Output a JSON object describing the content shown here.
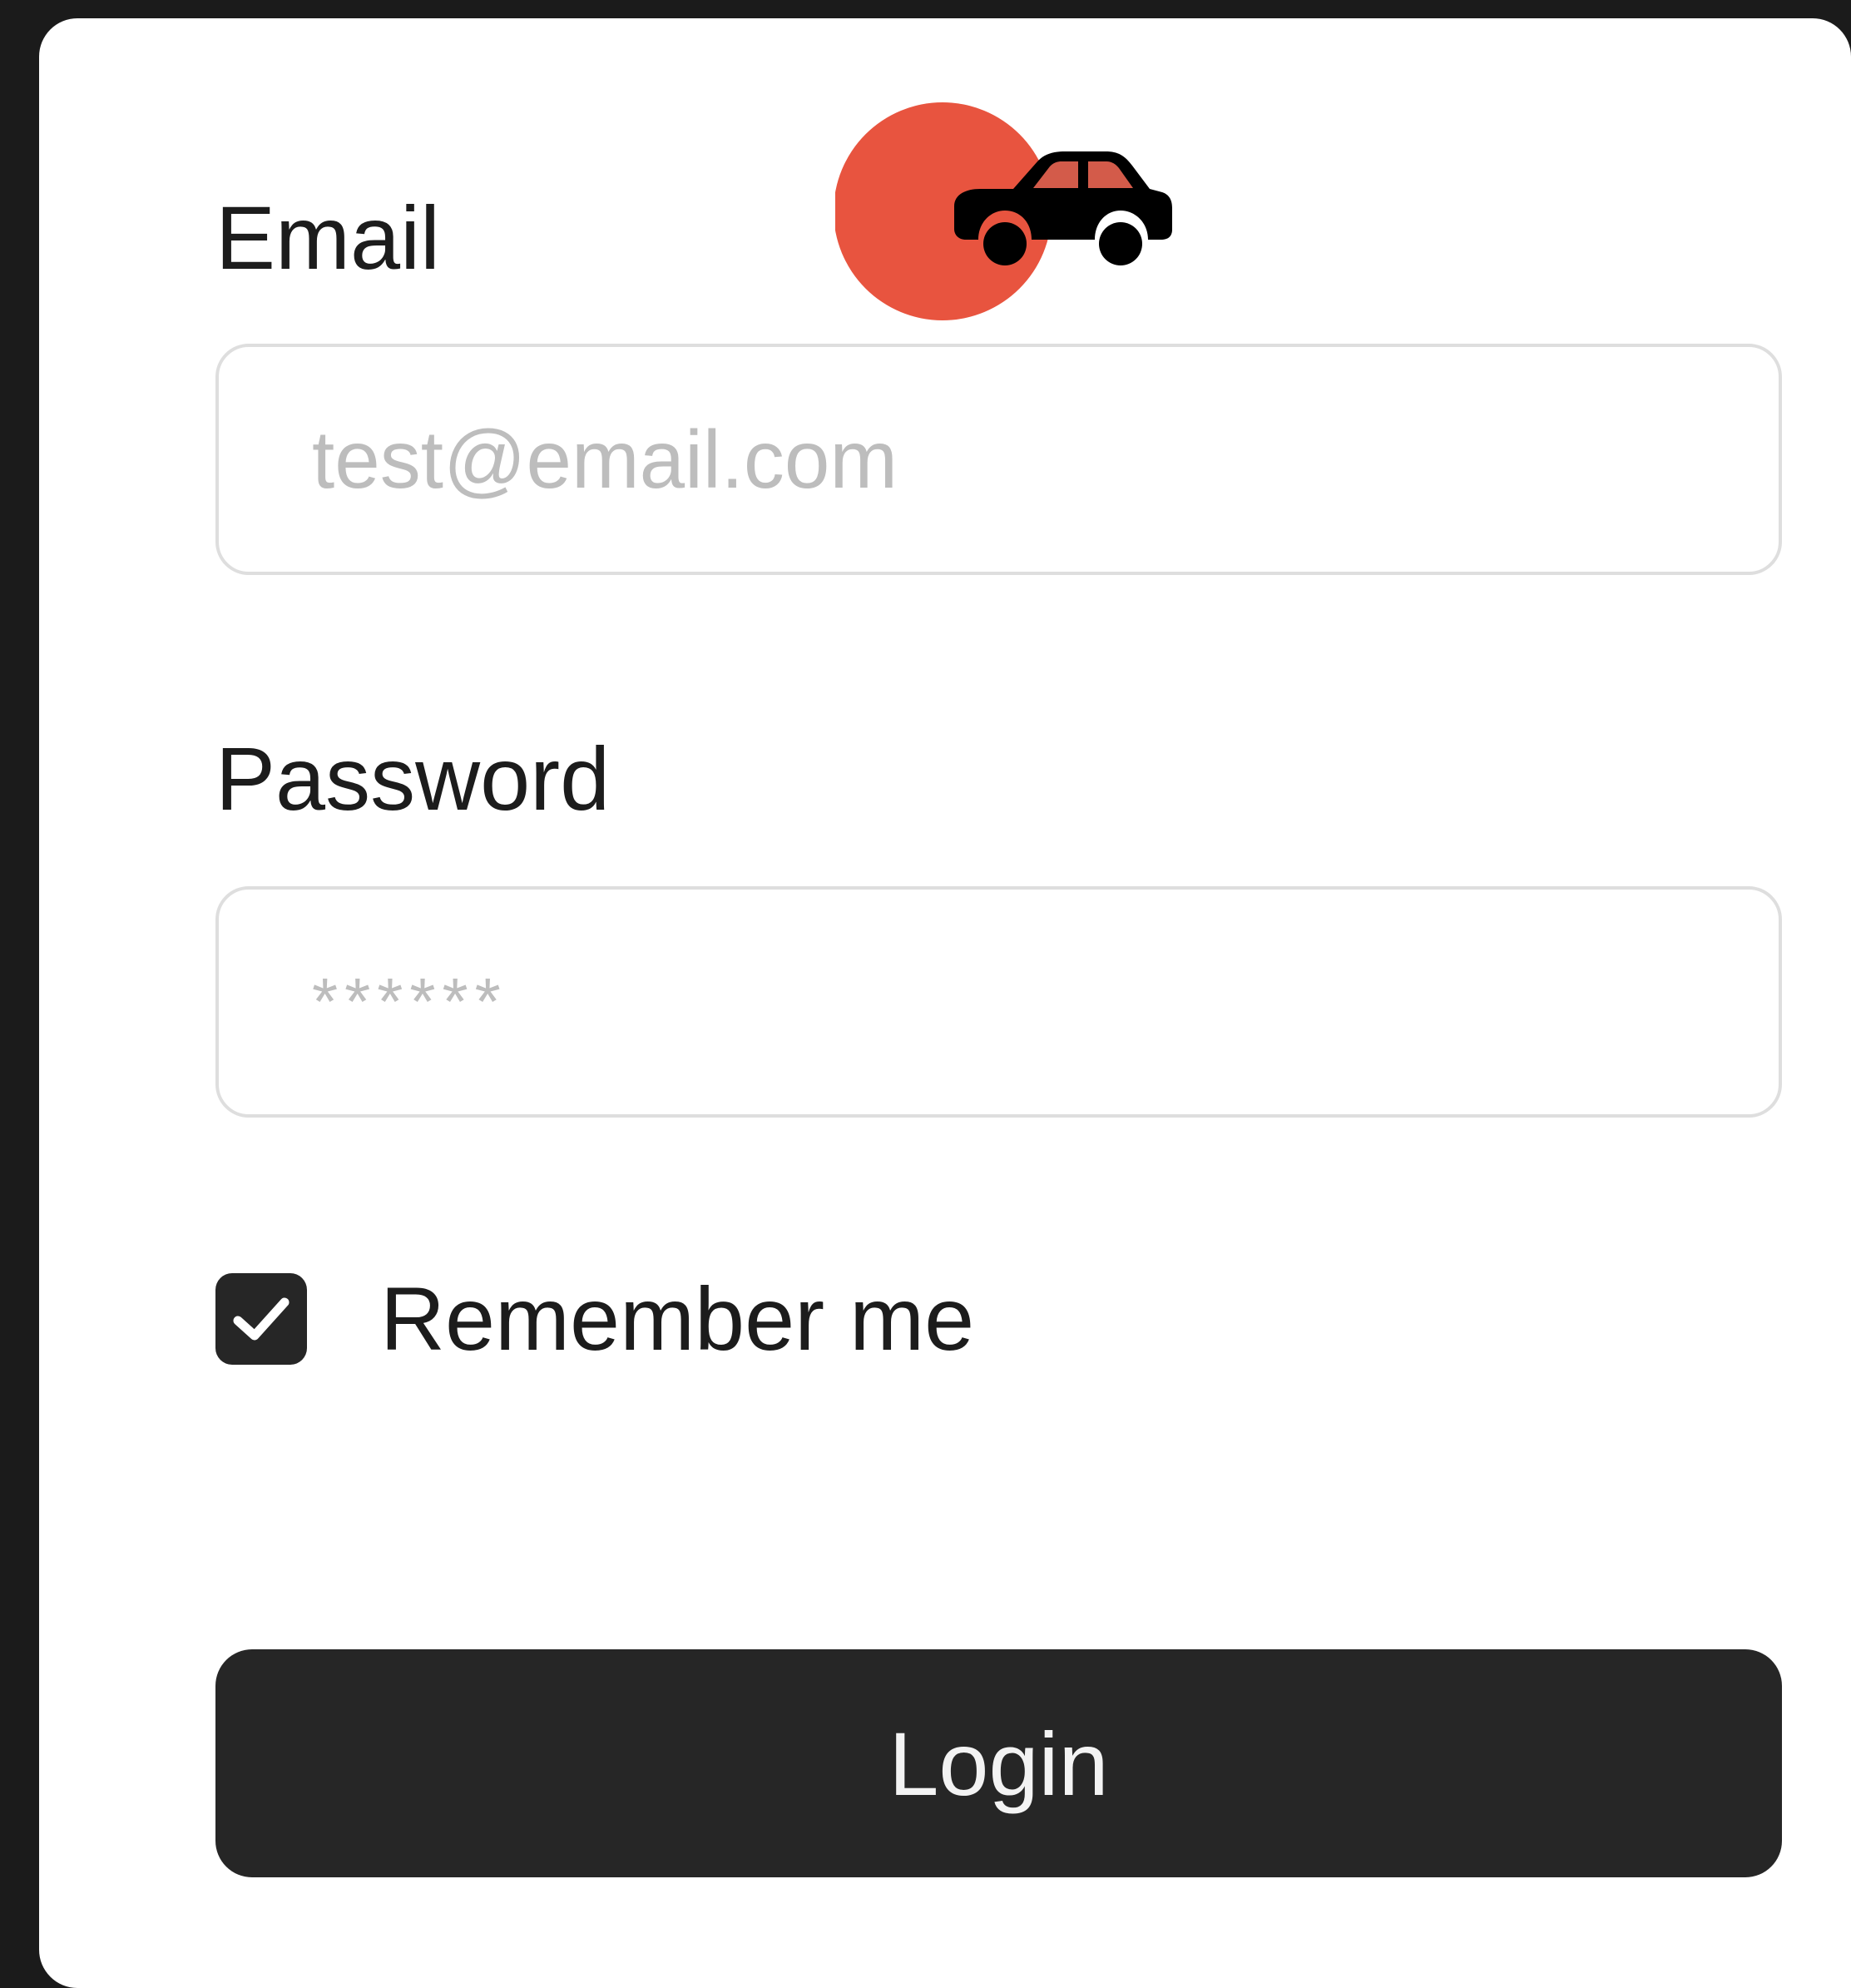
{
  "login_form": {
    "logo_icon": "car-icon",
    "colors": {
      "accent": "#E8543F",
      "button": "#262626",
      "input_border": "#DEDEDE"
    },
    "email": {
      "label": "Email",
      "value": "",
      "placeholder": "test@email.com"
    },
    "password": {
      "label": "Password",
      "value": "",
      "placeholder": "******"
    },
    "remember_me": {
      "label": "Remember me",
      "checked": true
    },
    "login_button": {
      "label": "Login"
    }
  }
}
